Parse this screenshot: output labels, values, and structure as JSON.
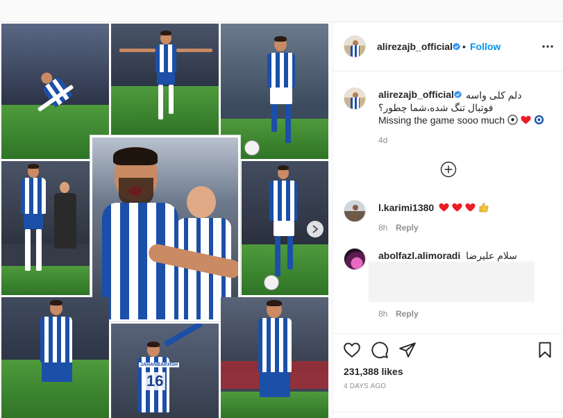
{
  "post": {
    "username": "alirezajb_official",
    "follow_label": "Follow",
    "dot": "•",
    "caption_persian_line1": "دلم کلی واسه",
    "caption_persian_line2": "فوتبال تنگ شده،شما چطور؟",
    "caption_english": "Missing the game sooo much",
    "caption_time": "4d",
    "likes": "231,388 likes",
    "time_ago": "4 DAYS AGO",
    "jersey_number_text": "16",
    "jersey_name_text": "JAHANBAKHSH"
  },
  "comments": [
    {
      "username": "l.karimi1380",
      "time": "8h",
      "reply_label": "Reply"
    },
    {
      "username": "abolfazl.alimoradi",
      "text": "سلام علیرضا",
      "time": "8h",
      "reply_label": "Reply"
    }
  ],
  "colors": {
    "accent": "#0095f6",
    "kit_blue": "#1b4fa8",
    "pitch_green": "#3f8a33",
    "heart_red": "#ed1c24"
  },
  "icons": {
    "verified": "verified-badge-icon",
    "more": "more-options-icon",
    "load_more": "load-more-comments-icon",
    "like": "heart-outline-icon",
    "comment": "comment-bubble-icon",
    "share": "paper-plane-icon",
    "save": "bookmark-icon",
    "next": "chevron-right-icon"
  }
}
